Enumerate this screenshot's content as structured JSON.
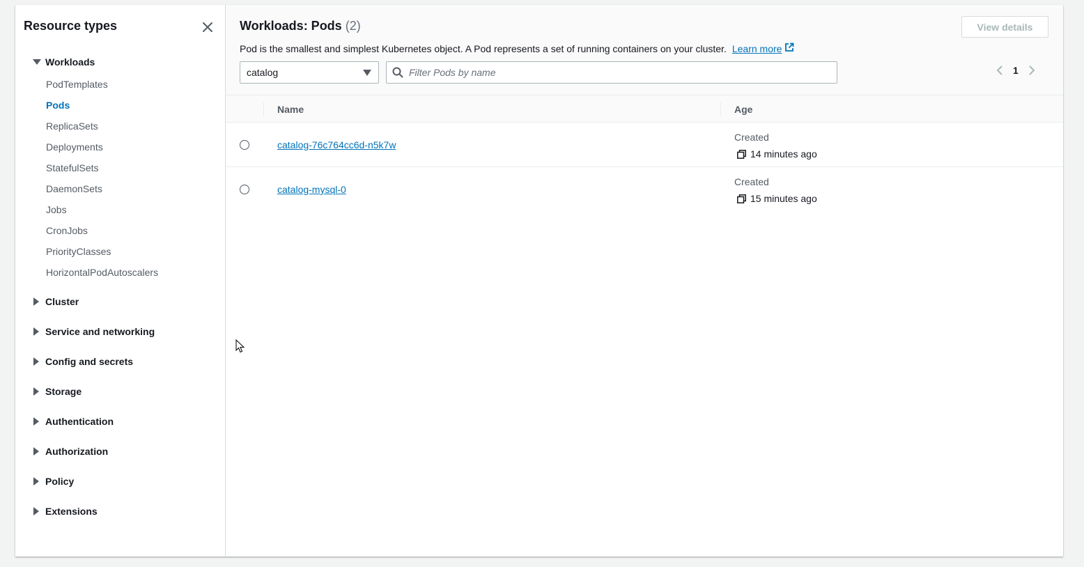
{
  "sidebar": {
    "title": "Resource types",
    "groups": [
      {
        "label": "Workloads",
        "expanded": true
      },
      {
        "label": "Cluster"
      },
      {
        "label": "Service and networking"
      },
      {
        "label": "Config and secrets"
      },
      {
        "label": "Storage"
      },
      {
        "label": "Authentication"
      },
      {
        "label": "Authorization"
      },
      {
        "label": "Policy"
      },
      {
        "label": "Extensions"
      }
    ],
    "workloads_items": [
      {
        "label": "PodTemplates"
      },
      {
        "label": "Pods",
        "active": true
      },
      {
        "label": "ReplicaSets"
      },
      {
        "label": "Deployments"
      },
      {
        "label": "StatefulSets"
      },
      {
        "label": "DaemonSets"
      },
      {
        "label": "Jobs"
      },
      {
        "label": "CronJobs"
      },
      {
        "label": "PriorityClasses"
      },
      {
        "label": "HorizontalPodAutoscalers"
      }
    ]
  },
  "header": {
    "title": "Workloads: Pods",
    "count": "(2)",
    "view_details": "View details",
    "description": "Pod is the smallest and simplest Kubernetes object. A Pod represents a set of running containers on your cluster.",
    "learn_more": "Learn more"
  },
  "filters": {
    "namespace": "catalog",
    "search_placeholder": "Filter Pods by name",
    "page": "1"
  },
  "table": {
    "columns": [
      "Name",
      "Age"
    ],
    "rows": [
      {
        "name": "catalog-76c764cc6d-n5k7w",
        "age_label": "Created",
        "age": "14 minutes ago"
      },
      {
        "name": "catalog-mysql-0",
        "age_label": "Created",
        "age": "15 minutes ago"
      }
    ]
  },
  "colors": {
    "link": "#0073bb",
    "text": "#16191f",
    "muted": "#545b64",
    "border": "#eaeded"
  }
}
